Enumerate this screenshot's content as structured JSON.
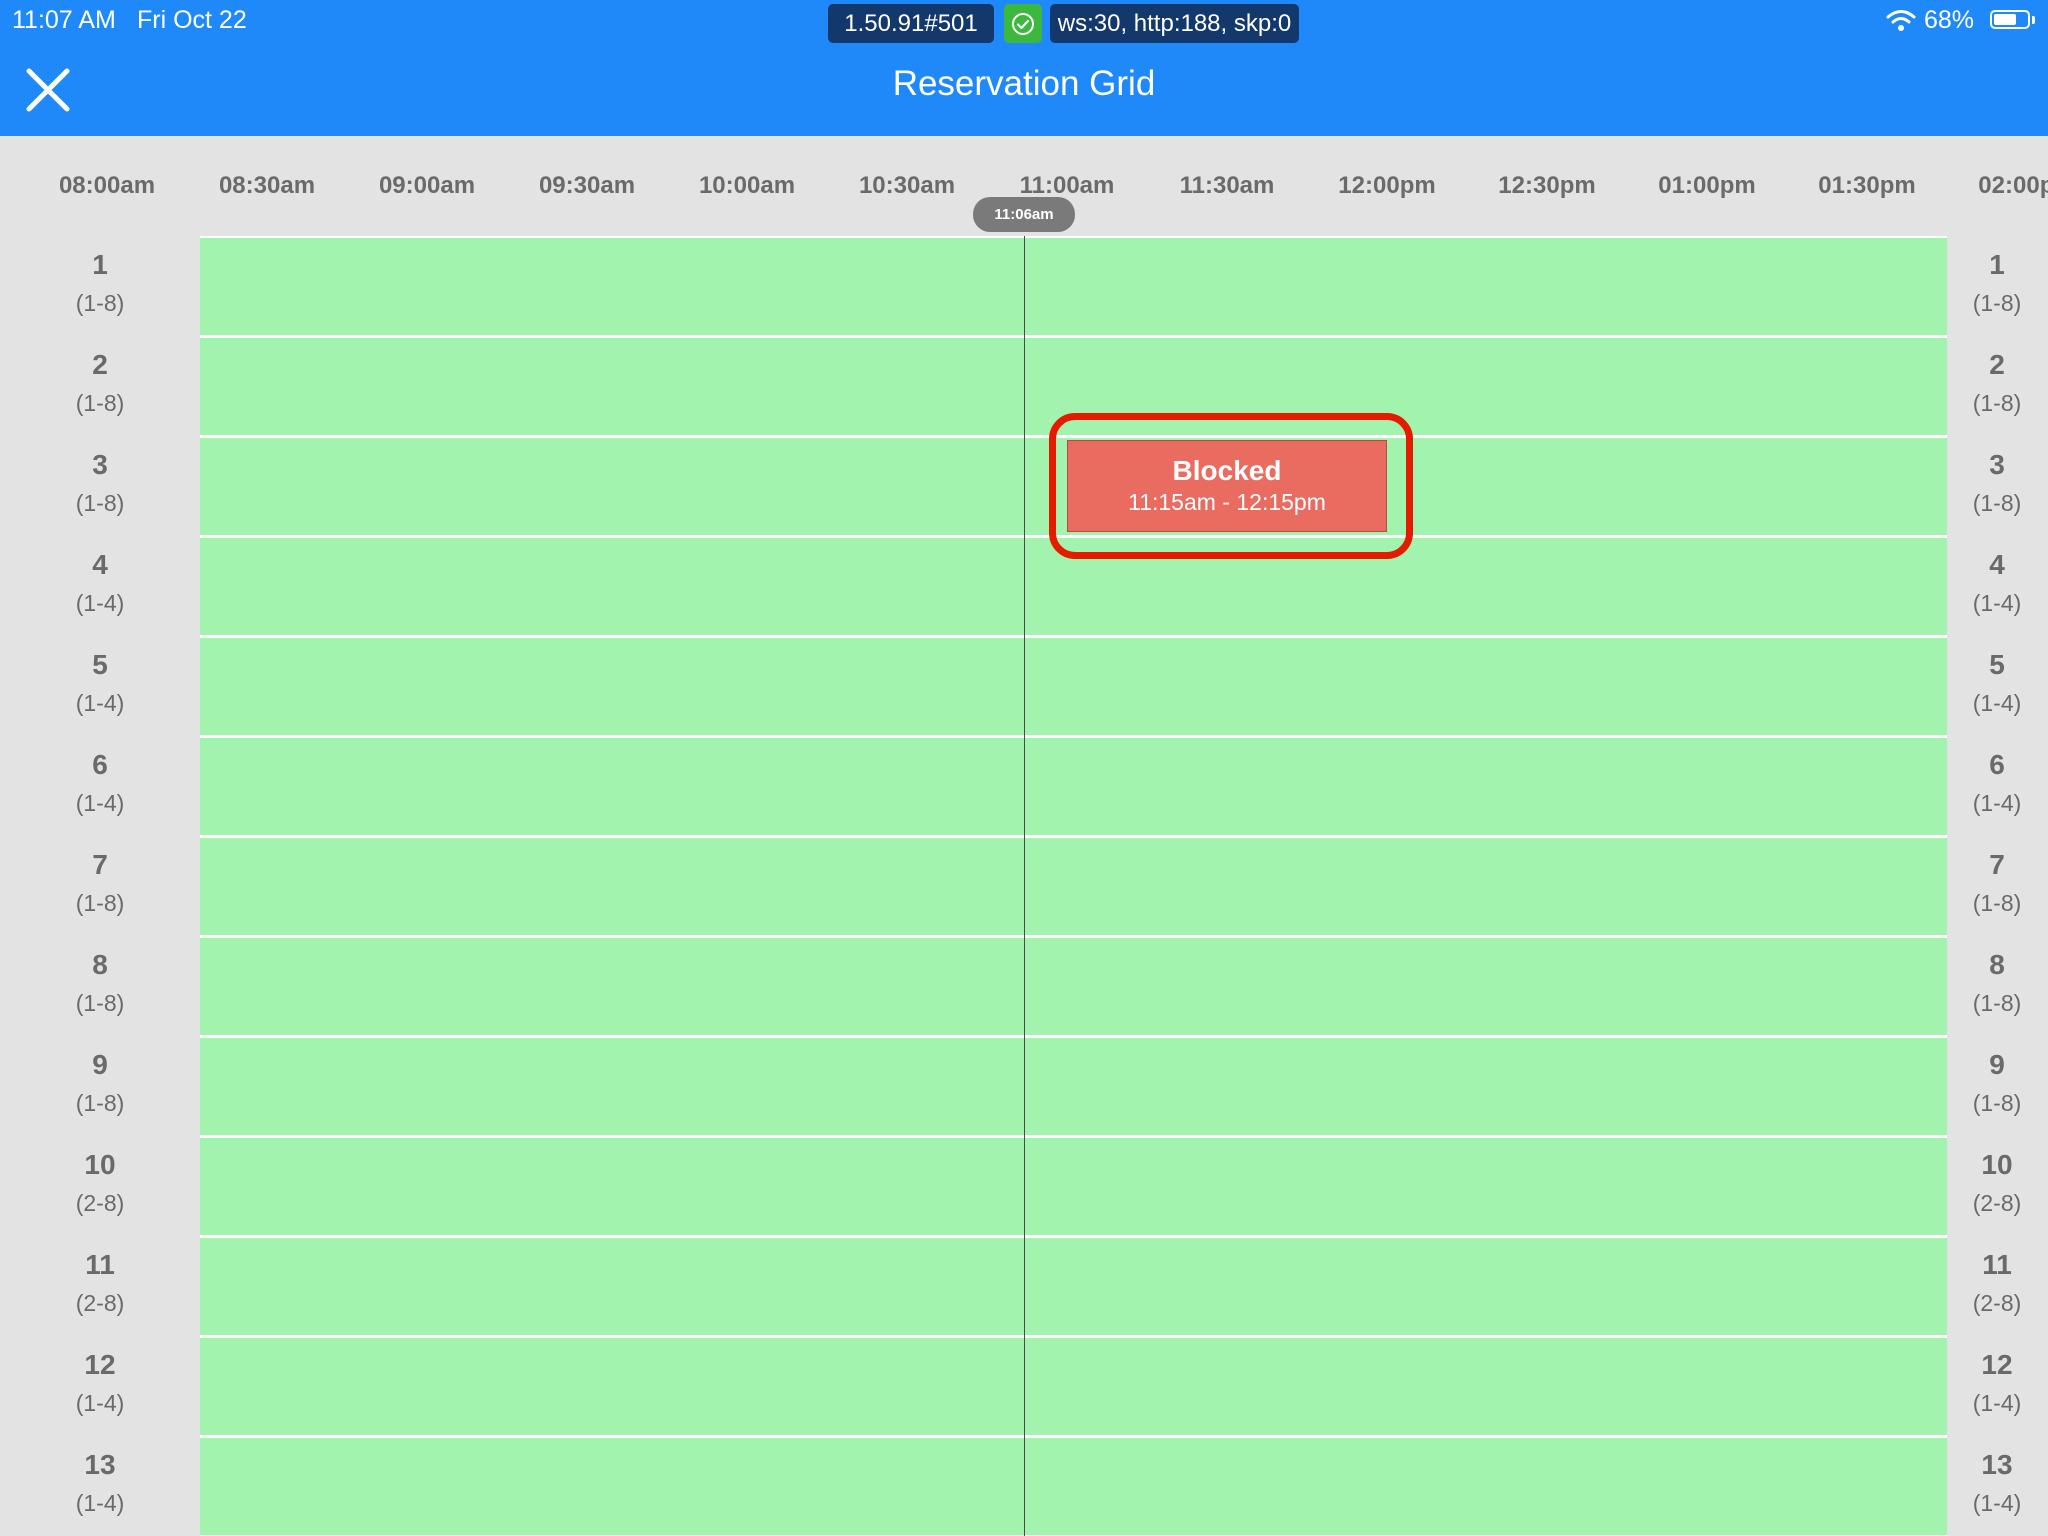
{
  "status_bar": {
    "time": "11:07 AM",
    "date": "Fri Oct 22",
    "battery": "68%",
    "battery_level": 0.68,
    "debug_version": "1.50.91#501",
    "debug_stats": "ws:30, http:188, skp:0"
  },
  "header": {
    "title": "Reservation Grid"
  },
  "time_axis": {
    "labels": [
      "08:00am",
      "08:30am",
      "09:00am",
      "09:30am",
      "10:00am",
      "10:30am",
      "11:00am",
      "11:30am",
      "12:00pm",
      "12:30pm",
      "01:00pm",
      "01:30pm",
      "02:00pm"
    ],
    "current_time": "11:06am"
  },
  "tables": [
    {
      "number": "1",
      "capacity": "(1-8)"
    },
    {
      "number": "2",
      "capacity": "(1-8)"
    },
    {
      "number": "3",
      "capacity": "(1-8)"
    },
    {
      "number": "4",
      "capacity": "(1-4)"
    },
    {
      "number": "5",
      "capacity": "(1-4)"
    },
    {
      "number": "6",
      "capacity": "(1-4)"
    },
    {
      "number": "7",
      "capacity": "(1-8)"
    },
    {
      "number": "8",
      "capacity": "(1-8)"
    },
    {
      "number": "9",
      "capacity": "(1-8)"
    },
    {
      "number": "10",
      "capacity": "(2-8)"
    },
    {
      "number": "11",
      "capacity": "(2-8)"
    },
    {
      "number": "12",
      "capacity": "(1-4)"
    },
    {
      "number": "13",
      "capacity": "(1-4)"
    }
  ],
  "blocked": {
    "title": "Blocked",
    "time_range": "11:15am - 12:15pm",
    "table": "3"
  },
  "colors": {
    "header": "#2089f9",
    "available": "#a2f3ad",
    "blocked": "#ea6b60",
    "highlight": "#e51b00"
  }
}
